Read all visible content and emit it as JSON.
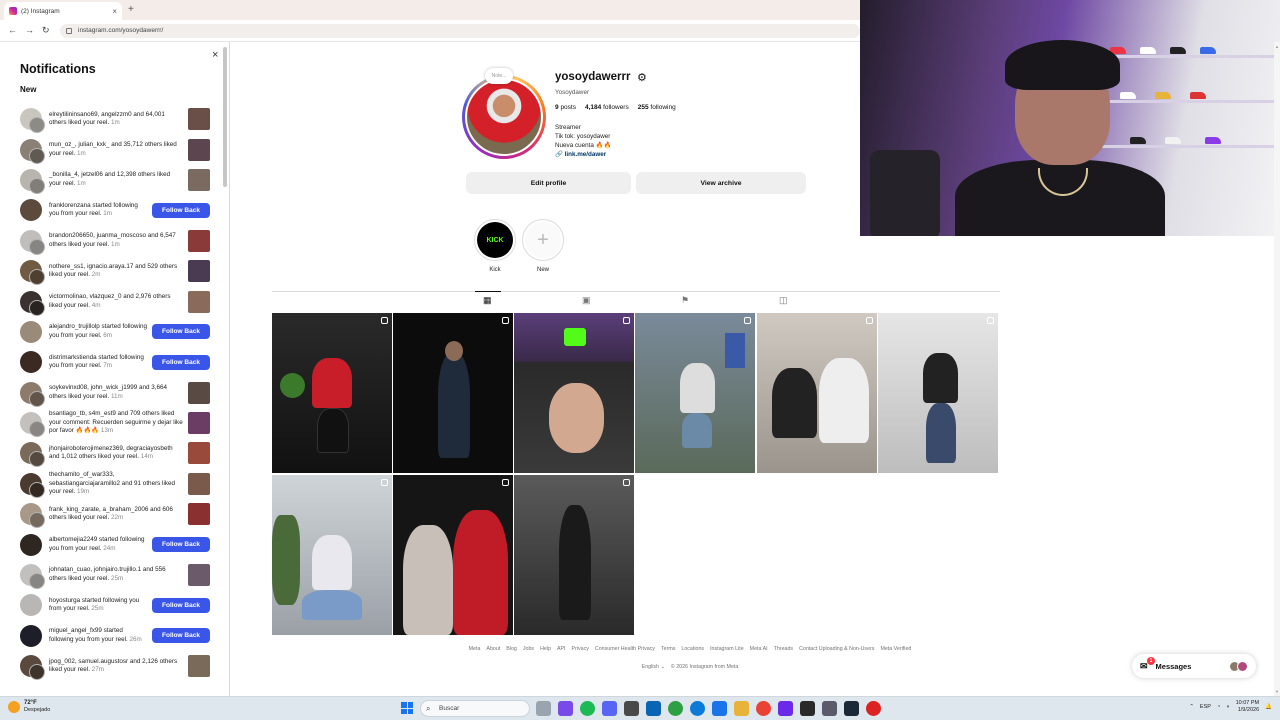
{
  "browser": {
    "tab_title": "(2) Instagram",
    "new_tab": "+",
    "close_tab": "×",
    "url": "instagram.com/yosoydawerrr/",
    "back": "←",
    "forward": "→",
    "reload": "↻"
  },
  "notifications": {
    "title": "Notifications",
    "close": "×",
    "section_new": "New",
    "follow_back_label": "Follow Back",
    "items": [
      {
        "type": "like",
        "text": "elreytilininsano69, angelzzm0 and 64,001 others liked your reel.",
        "time": "1m",
        "avatar_color": "#c9c6c0",
        "thumb_color": "#6a4e48"
      },
      {
        "type": "like",
        "text": "mun_oz_, julian_kxk_ and 35,712 others liked your reel.",
        "time": "1m",
        "avatar_color": "#8a8076",
        "thumb_color": "#5d4550"
      },
      {
        "type": "like",
        "text": "_bonilla_4, jetzel06 and 12,398 others liked your reel.",
        "time": "1m",
        "avatar_color": "#b8b4ae",
        "thumb_color": "#7a6a60"
      },
      {
        "type": "follow",
        "text": "franklorenzana started following you from your reel.",
        "time": "1m",
        "avatar_color": "#5c4a3c"
      },
      {
        "type": "like",
        "text": "brandon206650, juanma_moscoso and 6,547 others liked your reel.",
        "time": "1m",
        "avatar_color": "#c0bebc",
        "thumb_color": "#8b3a3a"
      },
      {
        "type": "like",
        "text": "nothere_ss1, ignacio.araya.17 and 529 others liked your reel.",
        "time": "2m",
        "avatar_color": "#6f5a44",
        "thumb_color": "#4a3a52"
      },
      {
        "type": "like",
        "text": "victormolinao, vlazquez_0 and 2,976 others liked your reel.",
        "time": "4m",
        "avatar_color": "#3a3230",
        "thumb_color": "#8a6a5a"
      },
      {
        "type": "follow",
        "text": "alejandro_trujillolp started following you from your reel.",
        "time": "6m",
        "avatar_color": "#9a8a7a"
      },
      {
        "type": "follow",
        "text": "distrimarkstienda started following you from your reel.",
        "time": "7m",
        "avatar_color": "#3a2a22"
      },
      {
        "type": "like",
        "text": "soykevinxd08, john_wick_j1999 and 3,664 others liked your reel.",
        "time": "11m",
        "avatar_color": "#8c7a6a",
        "thumb_color": "#5a4a44"
      },
      {
        "type": "like",
        "text": "bsantiago_tb, s4m_est9 and 709 others liked your comment: Recuerden seguirme y dejar like por favor 🔥🔥🔥",
        "time": "13m",
        "avatar_color": "#c3c0bd",
        "thumb_color": "#6b3c64"
      },
      {
        "type": "like",
        "text": "jhonjairoboterojimenez369, degraciayosbeth and 1,012 others liked your reel.",
        "time": "14m",
        "avatar_color": "#7a6a5a",
        "thumb_color": "#9a4a3a"
      },
      {
        "type": "like",
        "text": "thechamito_of_war333, sebastiangarciajaramillo2 and 91 others liked your reel.",
        "time": "19m",
        "avatar_color": "#4a3a30",
        "thumb_color": "#7a5a4a"
      },
      {
        "type": "like",
        "text": "frank_king_zarate, a_braham_2006 and 606 others liked your reel.",
        "time": "22m",
        "avatar_color": "#a89888",
        "thumb_color": "#8a3030"
      },
      {
        "type": "follow",
        "text": "albertomejia2249 started following you from your reel.",
        "time": "24m",
        "avatar_color": "#2e2620"
      },
      {
        "type": "like",
        "text": "johnatan_cuao, johnjairo.trujillo.1 and 556 others liked your reel.",
        "time": "25m",
        "avatar_color": "#c2c0be",
        "thumb_color": "#6a5a6a"
      },
      {
        "type": "follow",
        "text": "hoyosturga started following you from your reel.",
        "time": "25m",
        "avatar_color": "#b9b7b5"
      },
      {
        "type": "follow",
        "text": "miguel_angel_fx99 started following you from your reel.",
        "time": "26m",
        "avatar_color": "#1e1e28"
      },
      {
        "type": "like",
        "text": "jpog_002, samuel.augustosr and 2,126 others liked your reel.",
        "time": "27m",
        "avatar_color": "#5a4a3e",
        "thumb_color": "#7a6a5a"
      }
    ]
  },
  "profile": {
    "note": "Note...",
    "username": "yosoydawerrr",
    "settings_icon": "⚙",
    "fullname": "Yosoydawer",
    "posts_count": "9",
    "posts_label": "posts",
    "followers_count": "4,184",
    "followers_label": "followers",
    "following_count": "255",
    "following_label": "following",
    "bio_line1": "Streamer",
    "bio_line2": "Tik tok: yosoydawer",
    "bio_line3": "Nueva cuenta 🔥🔥",
    "bio_link": "link.me/dawer",
    "edit_profile": "Edit profile",
    "view_archive": "View archive",
    "highlights": [
      {
        "label": "Kick",
        "inner": "KICK"
      },
      {
        "label": "New",
        "inner": "+"
      }
    ]
  },
  "footer": {
    "links": [
      "Meta",
      "About",
      "Blog",
      "Jobs",
      "Help",
      "API",
      "Privacy",
      "Consumer Health Privacy",
      "Terms",
      "Locations",
      "Instagram Lite",
      "Meta AI",
      "Threads",
      "Contact Uploading & Non-Users",
      "Meta Verified"
    ],
    "language": "English ⌄",
    "copyright": "© 2026 Instagram from Meta"
  },
  "messages": {
    "label": "Messages",
    "badge": "1"
  },
  "taskbar": {
    "temperature": "72°F",
    "weather": "Despejado",
    "search_placeholder": "Buscar",
    "lang": "ESP",
    "time": "10:07 PM",
    "date": "1/9/2026"
  },
  "colors": {
    "follow_button": "#3a56e8",
    "link": "#00376b",
    "kick_green": "#53fc18"
  }
}
